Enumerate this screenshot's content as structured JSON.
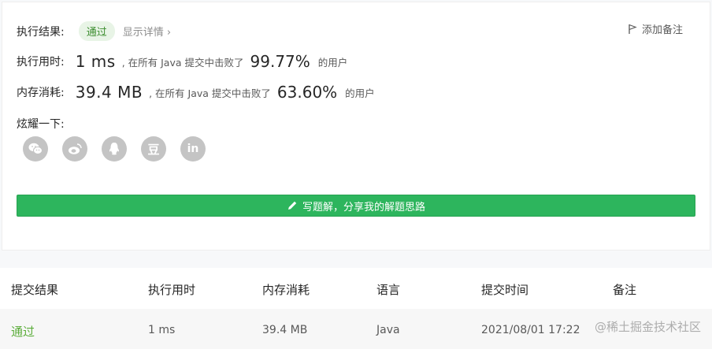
{
  "result": {
    "label": "执行结果:",
    "status": "通过",
    "detail_link": "显示详情",
    "add_note": "添加备注"
  },
  "runtime": {
    "label": "执行用时:",
    "value": "1 ms",
    "text_before": ", 在所有 Java 提交中击败了",
    "percent": "99.77%",
    "text_after": "的用户"
  },
  "memory": {
    "label": "内存消耗:",
    "value": "39.4 MB",
    "text_before": ", 在所有 Java 提交中击败了",
    "percent": "63.60%",
    "text_after": "的用户"
  },
  "share": {
    "label": "炫耀一下:",
    "icons": [
      "wechat-icon",
      "weibo-icon",
      "qq-icon",
      "douban-icon",
      "linkedin-icon"
    ],
    "douban_text": "豆",
    "linkedin_text": "in"
  },
  "write_solution": "写题解，分享我的解题思路",
  "table": {
    "headers": [
      "提交结果",
      "执行用时",
      "内存消耗",
      "语言",
      "提交时间",
      "备注"
    ],
    "rows": [
      {
        "status": "通过",
        "runtime": "1 ms",
        "memory": "39.4 MB",
        "language": "Java",
        "time": "2021/08/01 17:22"
      }
    ]
  },
  "watermark": "@稀土掘金技术社区",
  "colors": {
    "accent_green": "#2db55d",
    "pass_green": "#5cad3b",
    "badge_bg": "#e8f4e6"
  }
}
